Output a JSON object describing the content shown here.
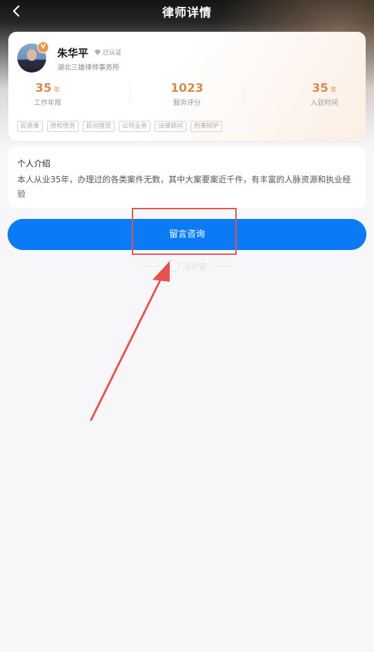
{
  "header": {
    "title": "律师详情",
    "back_icon": "chevron-left-icon"
  },
  "profile": {
    "name": "朱华平",
    "avatar_badge": "V",
    "verified_label": "已认证",
    "firm": "湖北三雄律师事务所",
    "stats": [
      {
        "value": "35",
        "unit": "年",
        "label": "工作年限"
      },
      {
        "value": "1023",
        "unit": "",
        "label": "服务评分"
      },
      {
        "value": "35",
        "unit": "年",
        "label": "入驻时间"
      }
    ],
    "tags": [
      "民商事",
      "债权债务",
      "民间借贷",
      "公司业务",
      "法律顾问",
      "刑事辩护"
    ]
  },
  "intro": {
    "title": "个人介绍",
    "text": "本人从业35年，办理过的各类案件无数，其中大案要案近千件，有丰富的人脉资源和执业经验"
  },
  "consult_button": {
    "label": "留言咨询",
    "color": "#0a7bf5"
  },
  "footer": {
    "brand": "法老婆"
  },
  "annotation": {
    "highlight_color": "#e8524e"
  }
}
